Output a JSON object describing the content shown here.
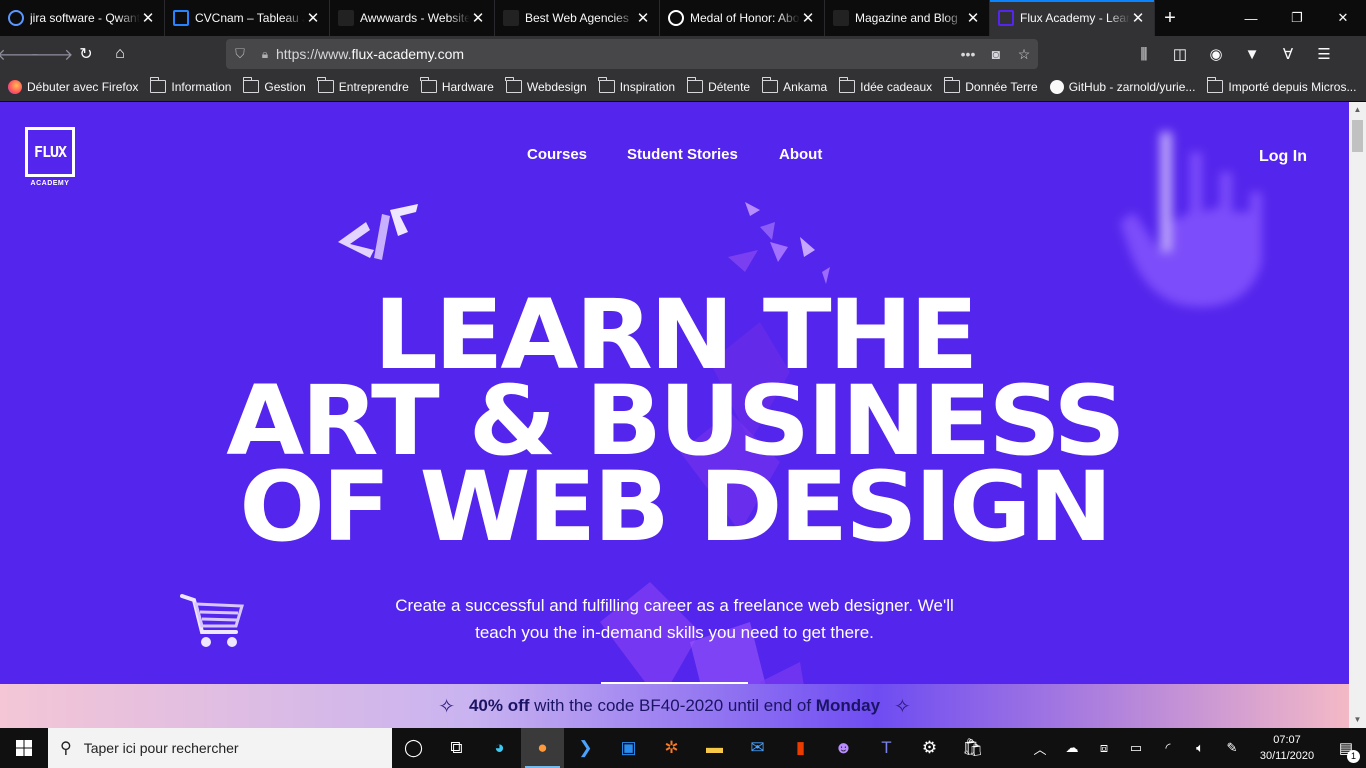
{
  "browser": {
    "tabs": [
      {
        "title": "jira software - Qwant",
        "favicon": "qwant-icon",
        "color": "#5c97ff",
        "active": false
      },
      {
        "title": "CVCnam – Tableau Jira",
        "favicon": "jira-icon",
        "color": "#2684ff",
        "active": false
      },
      {
        "title": "Awwwards - Website Awards",
        "favicon": "awwwards-icon",
        "color": "#222222",
        "active": false
      },
      {
        "title": "Best Web Agencies",
        "favicon": "awwwards-icon",
        "color": "#222222",
        "active": false
      },
      {
        "title": "Medal of Honor: Above and Beyond",
        "favicon": "oculus-icon",
        "color": "#ffffff",
        "active": false
      },
      {
        "title": "Magazine and Blog",
        "favicon": "awwwards-icon",
        "color": "#222222",
        "active": false
      },
      {
        "title": "Flux Academy - Learn Web Design",
        "favicon": "flux-icon",
        "color": "#5425ec",
        "active": true
      }
    ],
    "tab_close_glyph": "✕",
    "newtab_glyph": "+",
    "url_prefix": "https://www.",
    "url_host": "flux-academy.com",
    "bookmarks": [
      {
        "label": "Débuter avec Firefox",
        "icon": "firefox-icon"
      },
      {
        "label": "Information",
        "icon": "folder-icon"
      },
      {
        "label": "Gestion",
        "icon": "folder-icon"
      },
      {
        "label": "Entreprendre",
        "icon": "folder-icon"
      },
      {
        "label": "Hardware",
        "icon": "folder-icon"
      },
      {
        "label": "Webdesign",
        "icon": "folder-icon"
      },
      {
        "label": "Inspiration",
        "icon": "folder-icon"
      },
      {
        "label": "Détente",
        "icon": "folder-icon"
      },
      {
        "label": "Ankama",
        "icon": "folder-icon"
      },
      {
        "label": "Idée cadeaux",
        "icon": "folder-icon"
      },
      {
        "label": "Donnée Terre",
        "icon": "folder-icon"
      },
      {
        "label": "GitHub - zarnold/yurie...",
        "icon": "github-icon"
      },
      {
        "label": "Importé depuis Micros...",
        "icon": "folder-icon"
      }
    ]
  },
  "site": {
    "logo_text": "FLUX",
    "logo_sub": "ACADEMY",
    "nav": [
      "Courses",
      "Student Stories",
      "About"
    ],
    "login": "Log In",
    "hero": [
      "LEARN THE",
      "ART & BUSINESS",
      "OF WEB DESIGN"
    ],
    "subtitle_line1": "Create a successful and fulfilling career as a freelance web designer. We'll",
    "subtitle_line2": "teach you the in-demand skills you need to get there.",
    "banner": {
      "bold_start": "40% off",
      "middle": " with the code BF40-2020 until end of ",
      "bold_end": "Monday"
    },
    "background_color": "#5425ec"
  },
  "taskbar": {
    "search_placeholder": "Taper ici pour rechercher",
    "time": "07:07",
    "date": "30/11/2020",
    "notifications_count": "1"
  }
}
